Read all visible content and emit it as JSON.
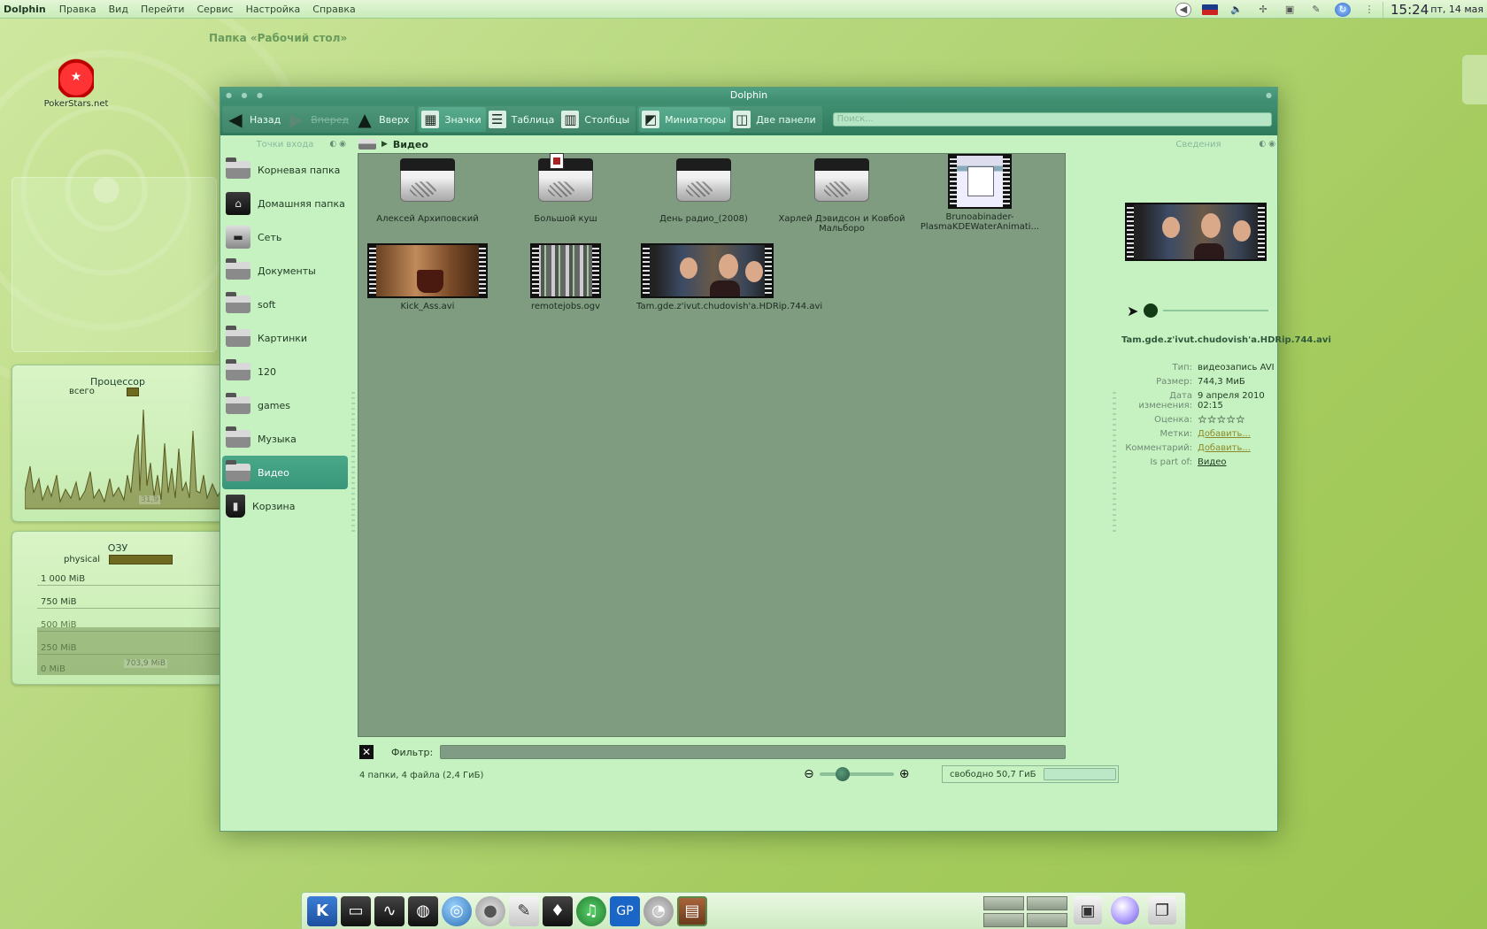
{
  "menubar": {
    "app": "Dolphin",
    "items": [
      "Правка",
      "Вид",
      "Перейти",
      "Сервис",
      "Настройка",
      "Справка"
    ],
    "clock": "15:24",
    "date": "пт, 14 мая"
  },
  "desktop": {
    "folder_title": "Папка «Рабочий стол»",
    "icon_label": "PokerStars.net"
  },
  "cpu_widget": {
    "title": "Процессор",
    "legend": "всего",
    "value": "31,9"
  },
  "ram_widget": {
    "title": "ОЗУ",
    "legend": "physical",
    "grid_labels": [
      "1 000 MiB",
      "750 MiB",
      "500 MiB",
      "250 MiB",
      "0 MiB"
    ],
    "value": "703,9 MiB"
  },
  "window": {
    "title": "Dolphin",
    "toolbar": {
      "back": "Назад",
      "forward": "Вперед",
      "up": "Вверх",
      "icons": "Значки",
      "details": "Таблица",
      "columns": "Столбцы",
      "previews": "Миниатюры",
      "split": "Две панели",
      "search_placeholder": "Поиск..."
    },
    "places": {
      "title": "Точки входа",
      "items": [
        "Корневая папка",
        "Домашняя папка",
        "Сеть",
        "Документы",
        "soft",
        "Картинки",
        "120",
        "games",
        "Музыка",
        "Видео",
        "Корзина"
      ]
    },
    "breadcrumb": "Видео",
    "files": [
      {
        "name": "Алексей Архиповский",
        "kind": "folder"
      },
      {
        "name": "Большой куш",
        "kind": "folder"
      },
      {
        "name": "День радио_(2008)",
        "kind": "folder"
      },
      {
        "name": "Харлей Дэвидсон и Ковбой Мальборо",
        "kind": "folder"
      },
      {
        "name": "Brunoabinader-PlasmaKDEWaterAnimati...",
        "kind": "video"
      },
      {
        "name": "Kick_Ass.avi",
        "kind": "video"
      },
      {
        "name": "remotejobs.ogv",
        "kind": "video"
      },
      {
        "name": "Tam.gde.z'ivut.chudovish'a.HDRip.744.avi",
        "kind": "video"
      }
    ],
    "filter_label": "Фильтр:",
    "status_text": "4 папки, 4 файла (2,4 ГиБ)",
    "free_space": "свободно 50,7 ГиБ",
    "info": {
      "title": "Сведения",
      "filename": "Tam.gde.z'ivut.chudovish'a.HDRip.744.avi",
      "rows": [
        {
          "k": "Тип:",
          "v": "видеозапись AVI"
        },
        {
          "k": "Размер:",
          "v": "744,3 МиБ"
        },
        {
          "k": "Дата изменения:",
          "v": "9 апреля 2010 02:15"
        },
        {
          "k": "Оценка:",
          "v": "☆☆☆☆☆"
        },
        {
          "k": "Метки:",
          "v": "Добавить..."
        },
        {
          "k": "Комментарий:",
          "v": "Добавить..."
        },
        {
          "k": "Is part of:",
          "v": "Видео"
        }
      ]
    }
  }
}
